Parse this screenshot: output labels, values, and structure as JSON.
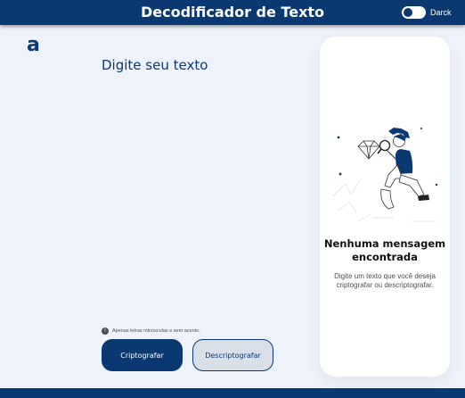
{
  "header": {
    "title": "Decodificador de Texto",
    "theme_toggle_label": "Darck",
    "theme_toggle_state": "off"
  },
  "logo": {
    "text": "a"
  },
  "input": {
    "placeholder": "Digite seu texto",
    "value": ""
  },
  "hint": {
    "icon": "info-icon",
    "text": "Apenas letras minúsculas e sem acento."
  },
  "buttons": {
    "encrypt_label": "Criptografar",
    "decrypt_label": "Descriptografar"
  },
  "output_panel": {
    "illustration": "person-with-magnifier-and-diamond",
    "title": "Nenhuma mensagem encontrada",
    "text": "Digite um texto que você deseja criptografar ou descriptografar."
  },
  "colors": {
    "primary": "#0a3871",
    "background": "#eef3fb",
    "panel": "#ffffff",
    "secondary_button": "#d8dfe8"
  }
}
